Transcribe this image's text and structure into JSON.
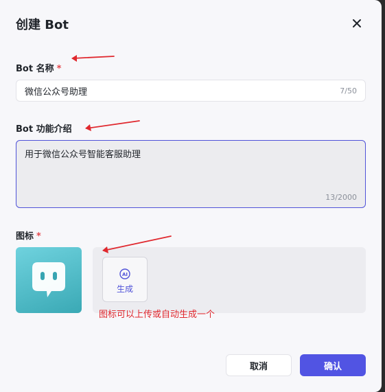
{
  "dialog": {
    "title": "创建 Bot",
    "close_icon": "close-icon"
  },
  "fields": {
    "name": {
      "label": "Bot 名称",
      "required_mark": "*",
      "value": "微信公众号助理",
      "counter": "7/50"
    },
    "description": {
      "label": "Bot 功能介绍",
      "value": "用于微信公众号智能客服助理",
      "counter": "13/2000"
    },
    "icon": {
      "label": "图标",
      "required_mark": "*",
      "avatar_icon": "chat-bubble-bot-icon",
      "generate_icon": "ai-sparkle-icon",
      "generate_label": "生成"
    }
  },
  "annotations": {
    "note": "图标可以上传或自动生成一个",
    "arrow_color": "#e0282e"
  },
  "footer": {
    "cancel_label": "取消",
    "confirm_label": "确认"
  },
  "colors": {
    "accent": "#5154e3",
    "required": "#e5484d"
  }
}
